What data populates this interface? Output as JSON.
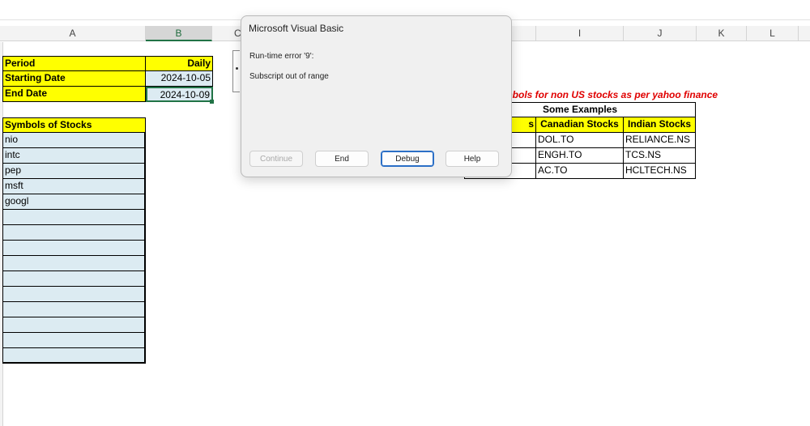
{
  "columns": [
    "A",
    "B",
    "C",
    "I",
    "J",
    "K",
    "L"
  ],
  "settings": {
    "period_label": "Period",
    "period_value": "Daily",
    "start_label": "Starting Date",
    "start_value": "2024-10-05",
    "end_label": "End Date",
    "end_value": "2024-10-09"
  },
  "symbols": {
    "header": "Symbols of Stocks",
    "items": [
      "nio",
      "intc",
      "pep",
      "msft",
      "googl",
      "",
      "",
      "",
      "",
      "",
      "",
      "",
      "",
      "",
      ""
    ]
  },
  "note": "mbols for non US stocks as per yahoo finance",
  "examples": {
    "title": "Some Examples",
    "headers": [
      "s",
      "Canadian Stocks",
      "Indian Stocks"
    ],
    "rows": [
      [
        "DOL.TO",
        "RELIANCE.NS"
      ],
      [
        "ENGH.TO",
        "TCS.NS"
      ],
      [
        "AC.TO",
        "HCLTECH.NS"
      ]
    ]
  },
  "dialog": {
    "title": "Microsoft Visual Basic",
    "line1": "Run-time error '9':",
    "line2": "Subscript out of range",
    "buttons": [
      "Continue",
      "End",
      "Debug",
      "Help"
    ]
  }
}
